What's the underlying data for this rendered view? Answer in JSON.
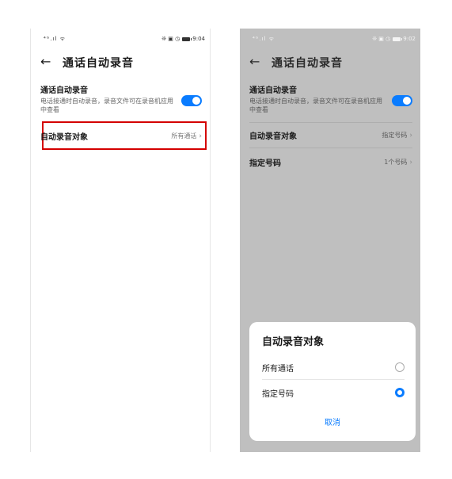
{
  "left_screen": {
    "status": {
      "signal": "⁴ᴳ.ıl",
      "wifi": "ᯤ",
      "icons": "❊ ▣ ◷",
      "time": "9:04"
    },
    "title": "通话自动录音",
    "auto_record": {
      "title": "通话自动录音",
      "description": "电话接通时自动录音，录音文件可在录音机应用中查看",
      "toggle_on": true
    },
    "target_row": {
      "label": "自动录音对象",
      "value": "所有通话"
    }
  },
  "right_screen": {
    "status": {
      "signal": "⁴ᴳ.ıl",
      "wifi": "ᯤ",
      "icons": "❊ ▣ ◷",
      "time": "9:02"
    },
    "title": "通话自动录音",
    "auto_record": {
      "title": "通话自动录音",
      "description": "电话接通时自动录音，录音文件可在录音机应用中查看",
      "toggle_on": true
    },
    "target_row": {
      "label": "自动录音对象",
      "value": "指定号码"
    },
    "numbers_row": {
      "label": "指定号码",
      "value": "1个号码"
    },
    "sheet": {
      "title": "自动录音对象",
      "options": [
        {
          "label": "所有通话",
          "selected": false
        },
        {
          "label": "指定号码",
          "selected": true
        }
      ],
      "cancel_label": "取消"
    }
  },
  "colors": {
    "accent": "#0a7cff",
    "highlight": "#d40000",
    "dim_overlay": "#bfbfbf"
  }
}
